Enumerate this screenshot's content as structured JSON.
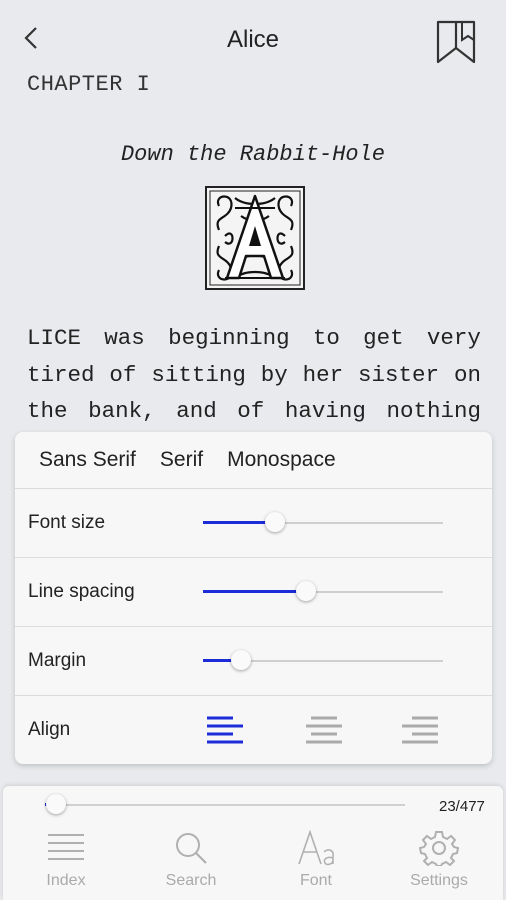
{
  "header": {
    "title": "Alice"
  },
  "chapter": {
    "heading": "CHAPTER I",
    "subtitle": "Down the Rabbit-Hole"
  },
  "body_lines": [
    [
      "LICE",
      "was",
      "beginning",
      "to",
      "get",
      "very"
    ],
    [
      "tired",
      "of",
      "sitting",
      "by",
      "her",
      "sister",
      "on"
    ],
    [
      "the",
      "bank,",
      "and",
      "of",
      "having",
      "nothing"
    ]
  ],
  "font_panel": {
    "fonts": [
      "Sans Serif",
      "Serif",
      "Monospace"
    ],
    "font_size": {
      "label": "Font size",
      "value": 0.3
    },
    "line_spacing": {
      "label": "Line spacing",
      "value": 0.43
    },
    "margin": {
      "label": "Margin",
      "value": 0.16
    },
    "align": {
      "label": "Align",
      "options": [
        "left",
        "center",
        "right"
      ],
      "selected": "left"
    }
  },
  "progress": {
    "value": 0.03,
    "label": "23/477"
  },
  "nav": [
    {
      "label": "Index",
      "icon": "list-icon"
    },
    {
      "label": "Search",
      "icon": "search-icon"
    },
    {
      "label": "Font",
      "icon": "font-icon"
    },
    {
      "label": "Settings",
      "icon": "gear-icon"
    }
  ],
  "colors": {
    "accent": "#1d2bd8",
    "inactive": "#aaaaaa"
  }
}
